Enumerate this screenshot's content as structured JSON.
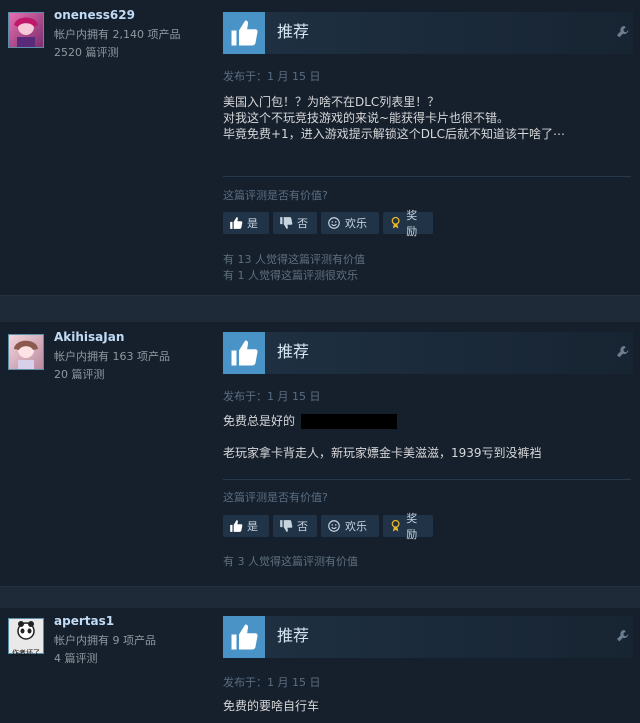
{
  "reviews": [
    {
      "username": "oneness629",
      "owned": "帐户内拥有 2,140 项产品",
      "review_count": "2520 篇评测",
      "recommendation": "推荐",
      "posted": "发布于：1 月 15 日",
      "lines": [
        "美国入门包！？为啥不在DLC列表里！？",
        "对我这个不玩竞技游戏的来说~能获得卡片也很不错。",
        "毕竟免费+1，进入游戏提示解锁这个DLC后就不知道该干啥了⋯"
      ],
      "helpful_question": "这篇评测是否有价值?",
      "buttons": {
        "yes": "是",
        "no": "否",
        "funny": "欢乐",
        "award": "奖励"
      },
      "stats": [
        "有 13 人觉得这篇评测有价值",
        "有 1 人觉得这篇评测很欢乐"
      ]
    },
    {
      "username": "AkihisaJan",
      "owned": "帐户内拥有 163 项产品",
      "review_count": "20 篇评测",
      "recommendation": "推荐",
      "posted": "发布于：1 月 15 日",
      "lines": [
        "免费总是好的",
        "老玩家拿卡背走人，新玩家嫖金卡美滋滋，1939亏到没裤裆"
      ],
      "helpful_question": "这篇评测是否有价值?",
      "buttons": {
        "yes": "是",
        "no": "否",
        "funny": "欢乐",
        "award": "奖励"
      },
      "stats": [
        "有 3 人觉得这篇评测有价值"
      ]
    },
    {
      "username": "apertas1",
      "owned": "帐户内拥有 9 项产品",
      "review_count": "4 篇评测",
      "avatar_text": "作者坏了",
      "recommendation": "推荐",
      "posted": "发布于：1 月 15 日",
      "lines": [
        "免费的要啥自行车"
      ]
    }
  ],
  "colors": {
    "background": "#1b2838",
    "thumb_box": "#4a93c6",
    "username": "#c1dbf4"
  }
}
